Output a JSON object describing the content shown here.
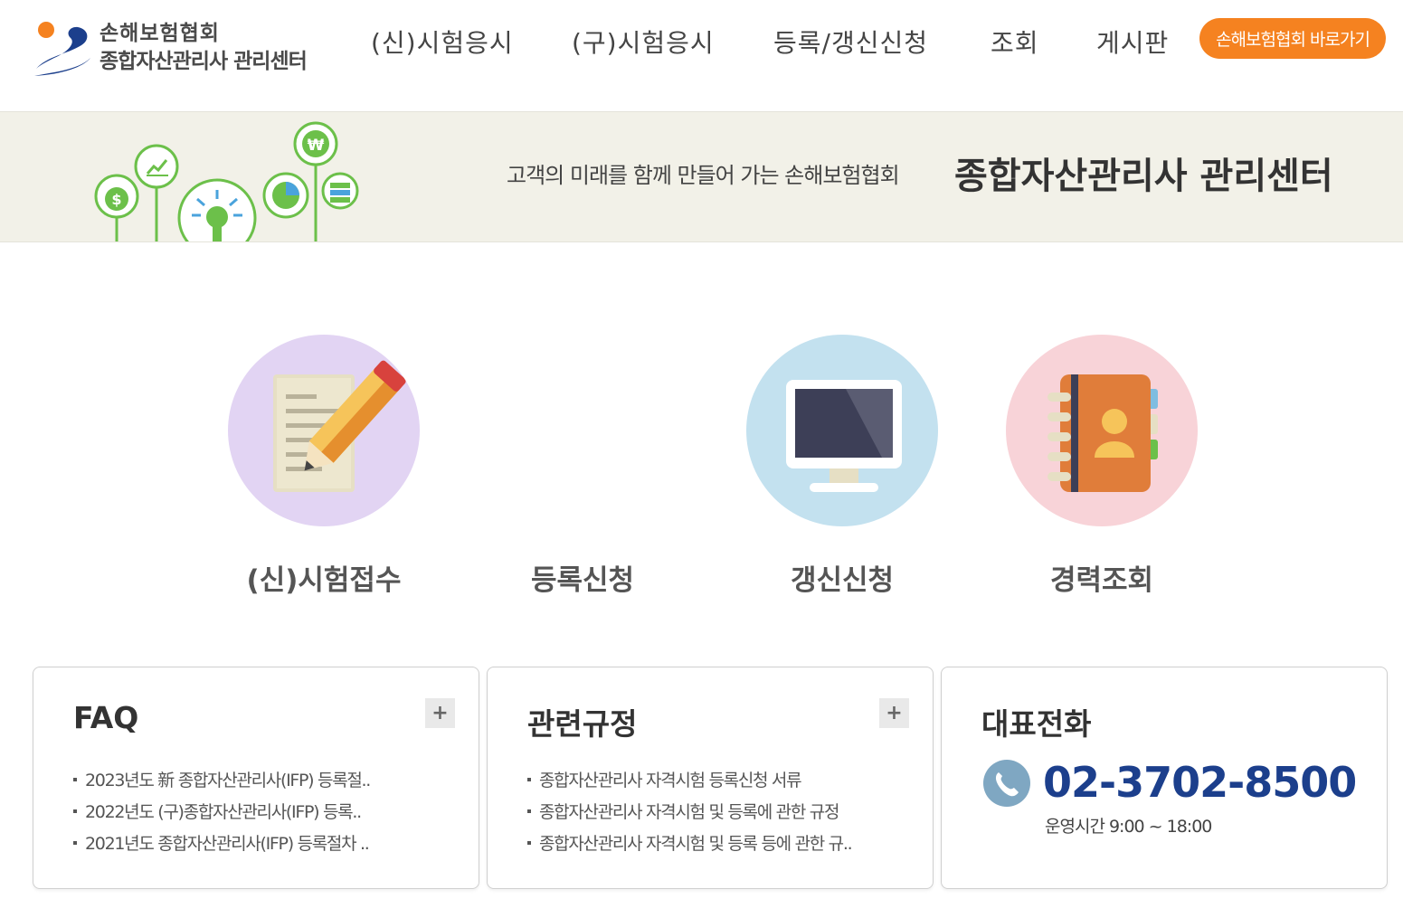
{
  "header": {
    "logo": {
      "line1": "손해보험협회",
      "line2": "종합자산관리사 관리센터"
    },
    "nav": [
      {
        "label": "(신)시험응시"
      },
      {
        "label": "(구)시험응시"
      },
      {
        "label": "등록/갱신신청"
      },
      {
        "label": "조회"
      },
      {
        "label": "게시판"
      }
    ],
    "cta_label": "손해보험협회 바로가기"
  },
  "banner": {
    "subtitle": "고객의 미래를 함께 만들어 가는 손해보험협회",
    "title": "종합자산관리사 관리센터"
  },
  "quick_menu": [
    {
      "label": "(신)시험접수",
      "icon": "pencil-document-icon"
    },
    {
      "label": "등록신청",
      "icon": ""
    },
    {
      "label": "갱신신청",
      "icon": "monitor-icon"
    },
    {
      "label": "경력조회",
      "icon": "address-book-icon"
    }
  ],
  "faq": {
    "title": "FAQ",
    "more_label": "+",
    "items": [
      "2023년도 新 종합자산관리사(IFP) 등록절..",
      "2022년도 (구)종합자산관리사(IFP) 등록..",
      "2021년도 종합자산관리사(IFP) 등록절차 .."
    ]
  },
  "regulations": {
    "title": "관련규정",
    "more_label": "+",
    "items": [
      "종합자산관리사 자격시험 등록신청 서류",
      "종합자산관리사 자격시험 및 등록에 관한 규정",
      "종합자산관리사 자격시험 및 등록 등에 관한 규.."
    ]
  },
  "contact": {
    "title": "대표전화",
    "phone": "02-3702-8500",
    "hours": "운영시간 9:00 ~ 18:00"
  },
  "colors": {
    "accent_orange": "#f58220",
    "brand_blue": "#1c3f8c",
    "banner_bg": "#f2f1e8",
    "icon_green": "#6cc04a"
  }
}
